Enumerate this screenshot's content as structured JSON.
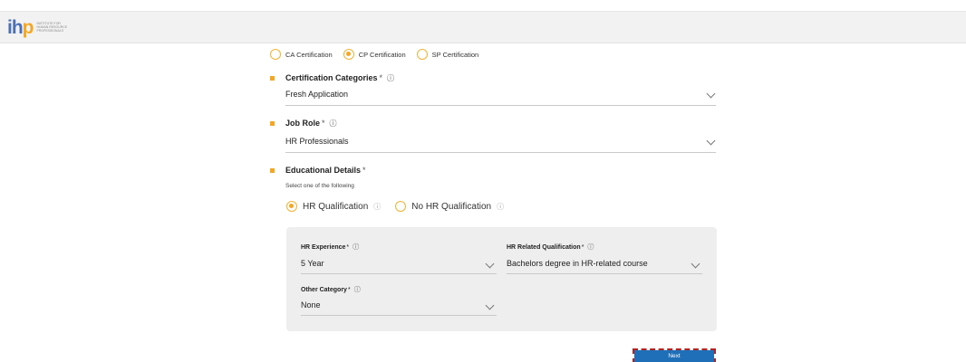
{
  "header": {
    "logo_text": "INSTITUTE FOR HUMAN RESOURCE PROFESSIONALS"
  },
  "certification": {
    "options": [
      "CA Certification",
      "CP Certification",
      "SP Certification"
    ],
    "selected": "CP Certification"
  },
  "categories": {
    "label": "Certification Categories",
    "required": "*",
    "value": "Fresh Application"
  },
  "job_role": {
    "label": "Job Role",
    "required": "*",
    "value": "HR Professionals"
  },
  "education": {
    "label": "Educational Details",
    "required": "*",
    "subtext": "Select one of the following",
    "options": [
      "HR Qualification",
      "No HR Qualification"
    ],
    "selected": "HR Qualification"
  },
  "panel": {
    "hr_experience": {
      "label": "HR Experience",
      "required": "*",
      "value": "5 Year"
    },
    "hr_related_qualification": {
      "label": "HR Related Qualification",
      "required": "*",
      "value": "Bachelors degree in HR-related course"
    },
    "other_category": {
      "label": "Other Category",
      "required": "*",
      "value": "None"
    }
  },
  "actions": {
    "next_label": "Next"
  },
  "colors": {
    "accent": "#f5a623",
    "primary_button": "#1f6fb8",
    "panel_bg": "#eeeeee"
  },
  "icons": {
    "info": "info-icon",
    "dropdown": "chevron-down-icon"
  }
}
